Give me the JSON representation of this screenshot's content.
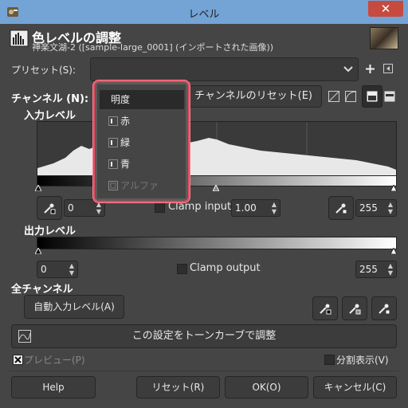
{
  "window": {
    "title": "レベル",
    "close_label": "✕"
  },
  "header": {
    "title": "色レベルの調整",
    "subtitle": "神楽文湖-2 ([sample-large_0001] (インポートされた画像))"
  },
  "presets": {
    "label": "プリセット(S):",
    "value": ""
  },
  "channel": {
    "label": "チャンネル (N):",
    "reset_label": "チャンネルのリセット(E)"
  },
  "popup": {
    "items": [
      "明度",
      "赤",
      "緑",
      "青",
      "アルファ"
    ]
  },
  "input_levels": {
    "label": "入力レベル",
    "low": "0",
    "gamma": "1.00",
    "high": "255",
    "clamp_label": "Clamp input"
  },
  "output_levels": {
    "label": "出力レベル",
    "low": "0",
    "high": "255",
    "clamp_label": "Clamp output"
  },
  "all_channels": {
    "label": "全チャンネル",
    "auto_label": "自動入力レベル(A)"
  },
  "curves_label": "この設定をトーンカーブで調整",
  "preview": {
    "label": "プレビュー(P)",
    "checked": true
  },
  "split": {
    "label": "分割表示(V)"
  },
  "buttons": {
    "help": "Help",
    "reset": "リセット(R)",
    "ok": "OK(O)",
    "cancel": "キャンセル(C)"
  }
}
